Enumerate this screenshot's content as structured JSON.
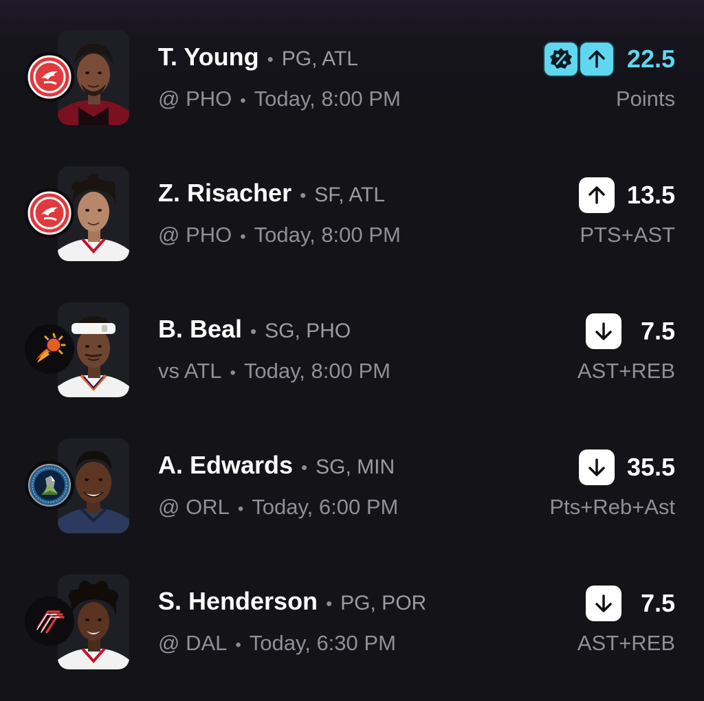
{
  "props": [
    {
      "name": "T. Young",
      "position_team": "PG, ATL",
      "matchup": "@ PHO",
      "time": "Today, 8:00 PM",
      "line": "22.5",
      "stat": "Points",
      "direction": "up",
      "promo": true,
      "team_logo": "hawks-logo-icon",
      "jersey_color": "#c8102e"
    },
    {
      "name": "Z. Risacher",
      "position_team": "SF, ATL",
      "matchup": "@ PHO",
      "time": "Today, 8:00 PM",
      "line": "13.5",
      "stat": "PTS+AST",
      "direction": "up",
      "promo": false,
      "team_logo": "hawks-logo-icon",
      "jersey_color": "#ffffff"
    },
    {
      "name": "B. Beal",
      "position_team": "SG, PHO",
      "matchup": "vs ATL",
      "time": "Today, 8:00 PM",
      "line": "7.5",
      "stat": "AST+REB",
      "direction": "down",
      "promo": false,
      "team_logo": "suns-logo-icon",
      "jersey_color": "#ffffff"
    },
    {
      "name": "A. Edwards",
      "position_team": "SG, MIN",
      "matchup": "@ ORL",
      "time": "Today, 6:00 PM",
      "line": "35.5",
      "stat": "Pts+Reb+Ast",
      "direction": "down",
      "promo": false,
      "team_logo": "timberwolves-logo-icon",
      "jersey_color": "#2b3a5e"
    },
    {
      "name": "S. Henderson",
      "position_team": "PG, POR",
      "matchup": "@ DAL",
      "time": "Today, 6:30 PM",
      "line": "7.5",
      "stat": "AST+REB",
      "direction": "down",
      "promo": false,
      "team_logo": "trail-blazers-logo-icon",
      "jersey_color": "#ffffff"
    }
  ],
  "separator": "•",
  "colors": {
    "background": "#131318",
    "promo_accent": "#5fd7ef",
    "muted_text": "#8f8f98",
    "hawks_red": "#e03a3e",
    "suns_orange": "#e56020",
    "wolves_navy": "#236192"
  }
}
